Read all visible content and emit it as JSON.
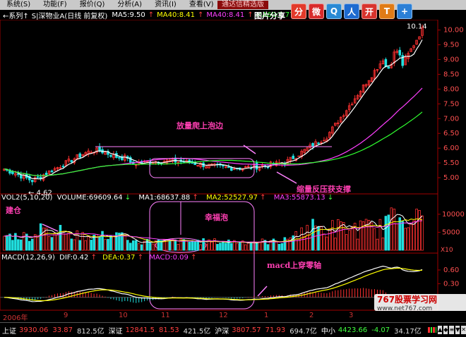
{
  "menu": [
    {
      "label": "系统(S)"
    },
    {
      "label": "功能(F)"
    },
    {
      "label": "报价(Q)"
    },
    {
      "label": "分析(A)"
    },
    {
      "label": "资讯(I)"
    },
    {
      "label": "查看(V)"
    },
    {
      "label": "帮助(H)"
    }
  ],
  "promo": "通达信精选版",
  "share_label": "图片分享",
  "share_icons": [
    {
      "name": "share-a-icon",
      "glyph": "分",
      "color": "#e23a2a"
    },
    {
      "name": "weibo-icon",
      "glyph": "微",
      "color": "#d92b2b"
    },
    {
      "name": "qq-weibo-icon",
      "glyph": "Q",
      "color": "#2a8ad4"
    },
    {
      "name": "renren-icon",
      "glyph": "人",
      "color": "#1e6bd0"
    },
    {
      "name": "kaixin-icon",
      "glyph": "开",
      "color": "#d8342d"
    },
    {
      "name": "tianya-icon",
      "glyph": "T",
      "color": "#e07b16"
    },
    {
      "name": "plus-share-icon",
      "glyph": "+",
      "color": "#2b7fd6"
    }
  ],
  "infobar": {
    "nav": "←系列↑",
    "title": "S|深物业A(日线 前复权)",
    "ma5": "MA5:9.50",
    "ma40": "MA40:8.41",
    "ma40b": "MA40:8.41",
    "ma60": "MA60:7.77"
  },
  "price_axis": [
    "10.00",
    "9.50",
    "9.00",
    "8.50",
    "8.00",
    "7.50",
    "7.00",
    "6.50",
    "6.00",
    "5.50",
    "5.00"
  ],
  "price_high": "10.14",
  "price_low": "4.62",
  "volume_panel": {
    "header": "VOL2(5,10,20)",
    "volume": "VOLUME:69609.64",
    "ma1": "MA1:68637.88",
    "ma2": "MA2:52527.97",
    "ma3": "MA3:55873.13",
    "axis": [
      "10000",
      "5000"
    ],
    "unit": "X10"
  },
  "macd_panel": {
    "header": "MACD(12,26,9)",
    "dif": "DIF:0.42",
    "dea": "DEA:0.37",
    "macd": "MACD:0.09",
    "axis": [
      "0.60",
      "0.30"
    ]
  },
  "annotations": {
    "breakout": "放量爬上泡边",
    "support": "缩量反压获支撑",
    "build": "建仓",
    "bubble": "幸福泡",
    "macd_cross": "macd上穿零轴"
  },
  "time_axis": [
    "2006年",
    "9",
    "10",
    "11",
    "12",
    "1",
    "2",
    "3"
  ],
  "watermark": {
    "title": "767股票学习网",
    "url": "www.net767.com"
  },
  "status": [
    {
      "name": "上证",
      "val": "3930.06",
      "chg": "33.87",
      "amt": "812.5亿",
      "dir": "up"
    },
    {
      "name": "深证",
      "val": "12841.5",
      "chg": "81.53",
      "amt": "421.5亿",
      "dir": "up"
    },
    {
      "name": "沪深",
      "val": "3807.57",
      "chg": "71.93",
      "amt": "694.7亿",
      "dir": "up"
    },
    {
      "name": "中小",
      "val": "4423.66",
      "chg": "-4.07",
      "amt": "34.17亿",
      "dir": "down"
    }
  ],
  "colors": {
    "up": "#ff3030",
    "down": "#20e0e0",
    "ma5": "#ffffff",
    "ma40": "#ff3fff",
    "ma60": "#30ff30",
    "annot": "#ff3fb2"
  }
}
